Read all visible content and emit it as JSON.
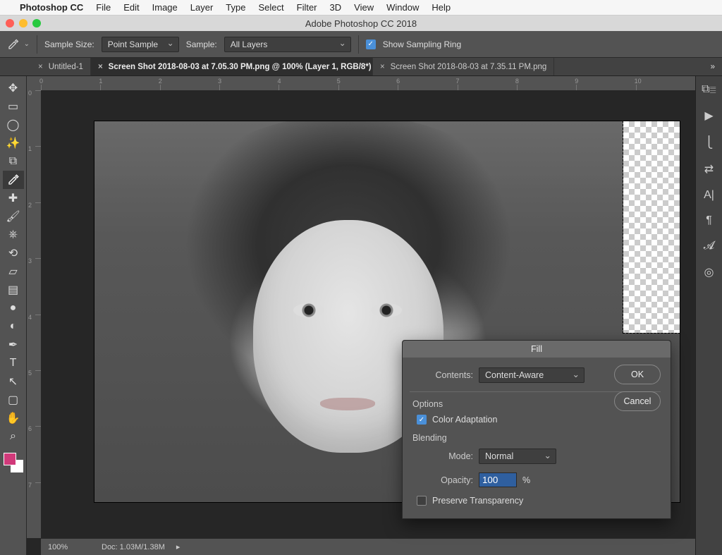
{
  "mac_menu": {
    "app": "Photoshop CC",
    "items": [
      "File",
      "Edit",
      "Image",
      "Layer",
      "Type",
      "Select",
      "Filter",
      "3D",
      "View",
      "Window",
      "Help"
    ]
  },
  "window": {
    "title": "Adobe Photoshop CC 2018"
  },
  "options_bar": {
    "sample_size_label": "Sample Size:",
    "sample_size_value": "Point Sample",
    "sample_label": "Sample:",
    "sample_value": "All Layers",
    "show_sampling_ring": "Show Sampling Ring"
  },
  "tabs": {
    "items": [
      {
        "label": "Untitled-1",
        "active": false
      },
      {
        "label": "Screen Shot 2018-08-03 at 7.05.30 PM.png @ 100% (Layer 1, RGB/8*) *",
        "active": true
      },
      {
        "label": "Screen Shot 2018-08-03 at 7.35.11 PM.png",
        "active": false
      }
    ]
  },
  "tools": {
    "left": [
      "move",
      "marquee",
      "lasso",
      "wand",
      "crop",
      "eyedropper",
      "healing",
      "brush",
      "stamp",
      "history",
      "eraser",
      "gradient",
      "blur",
      "dodge",
      "pen",
      "type",
      "path",
      "rect",
      "hand",
      "zoom"
    ],
    "icons": [
      "✥",
      "▭",
      "◯",
      "✨",
      "⧉",
      "👁",
      "✚",
      "🖌",
      "⎈",
      "⟲",
      "▱",
      "▤",
      "●",
      "◐",
      "✒",
      "T",
      "↖",
      "▢",
      "✋",
      "⌕"
    ],
    "selected": "eyedropper"
  },
  "ruler_h": [
    "0",
    "1",
    "2",
    "3",
    "4",
    "5",
    "6",
    "7",
    "8",
    "9",
    "10"
  ],
  "ruler_v": [
    "0",
    "1",
    "2",
    "3",
    "4",
    "5",
    "6",
    "7"
  ],
  "status": {
    "zoom": "100%",
    "doc": "Doc: 1.03M/1.38M"
  },
  "right_icons": [
    "⧉≣",
    "▶",
    "⎩",
    "⇄",
    "A|",
    "¶",
    "𝓐",
    "◎"
  ],
  "fill_dialog": {
    "title": "Fill",
    "contents_label": "Contents:",
    "contents_value": "Content-Aware",
    "options_label": "Options",
    "color_adaptation": "Color Adaptation",
    "blending_label": "Blending",
    "mode_label": "Mode:",
    "mode_value": "Normal",
    "opacity_label": "Opacity:",
    "opacity_value": "100",
    "opacity_unit": "%",
    "preserve_transparency": "Preserve Transparency",
    "ok": "OK",
    "cancel": "Cancel"
  }
}
